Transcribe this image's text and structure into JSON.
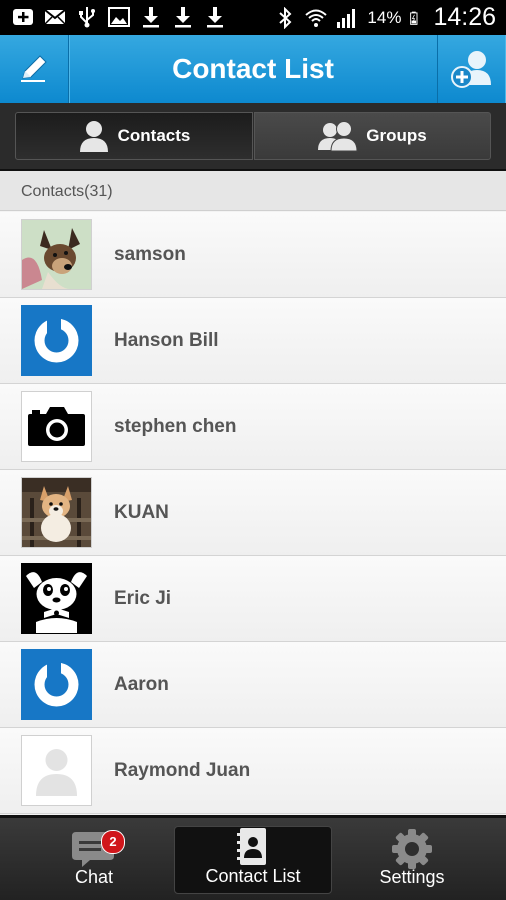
{
  "status_bar": {
    "left_icons": [
      "add-box-icon",
      "mail-icon",
      "usb-icon",
      "image-icon",
      "download-icon",
      "download-icon",
      "download-icon"
    ],
    "right_icons": [
      "bluetooth-icon",
      "wifi-icon",
      "signal-icon"
    ],
    "battery_percent": "14%",
    "time": "14:26"
  },
  "header": {
    "title": "Contact List",
    "left_icon": "pencil-icon",
    "right_icon": "add-contact-icon"
  },
  "segments": {
    "contacts_label": "Contacts",
    "groups_label": "Groups"
  },
  "section": {
    "label": "Contacts(31)"
  },
  "contacts": [
    {
      "name": "samson",
      "avatar": "dog-photo"
    },
    {
      "name": "Hanson Bill",
      "avatar": "blue-power-logo"
    },
    {
      "name": "stephen chen",
      "avatar": "camera-icon"
    },
    {
      "name": "KUAN",
      "avatar": "corgi-photo"
    },
    {
      "name": "Eric Ji",
      "avatar": "cartoon-dog"
    },
    {
      "name": "Aaron",
      "avatar": "blue-power-logo"
    },
    {
      "name": "Raymond Juan",
      "avatar": "default-person"
    }
  ],
  "tabs": {
    "chat_label": "Chat",
    "chat_badge": "2",
    "contact_list_label": "Contact List",
    "settings_label": "Settings"
  },
  "colors": {
    "header_blue": "#1a97d8",
    "badge_red": "#d0161b",
    "power_logo_blue": "#1777c6"
  }
}
